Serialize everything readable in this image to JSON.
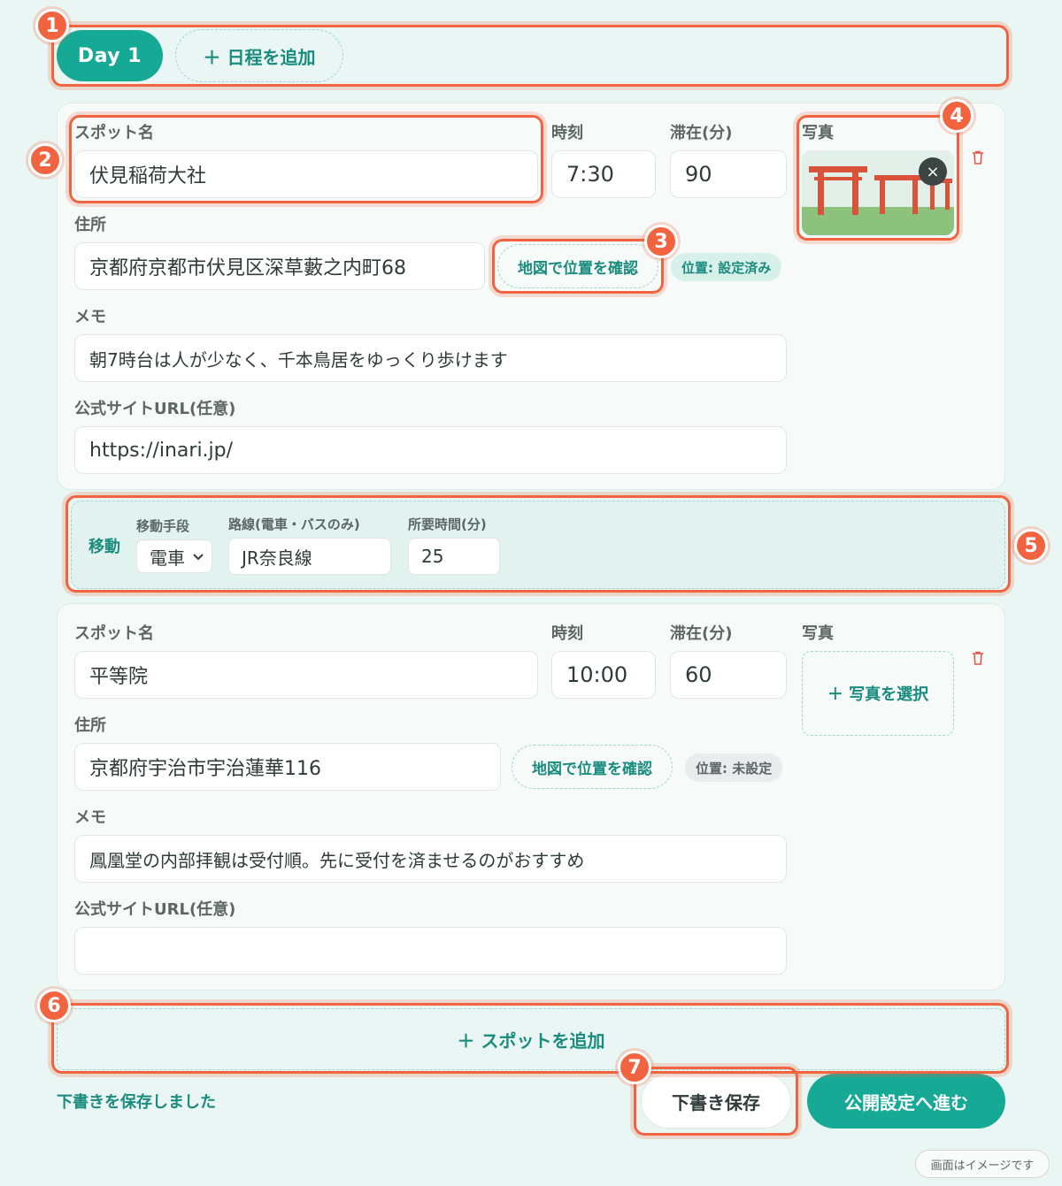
{
  "days": {
    "active_tab": "Day 1",
    "add_day_label": "＋ 日程を追加"
  },
  "spot1": {
    "labels": {
      "name": "スポット名",
      "time": "時刻",
      "stay": "滞在(分)",
      "photo": "写真",
      "address": "住所",
      "memo": "メモ",
      "url": "公式サイトURL(任意)"
    },
    "name": "伏見稲荷大社",
    "time": "7:30",
    "stay": "90",
    "address": "京都府京都市伏見区深草藪之内町68",
    "map_button": "地図で位置を確認",
    "location_status": "位置: 設定済み",
    "memo": "朝7時台は人が少なく、千本鳥居をゆっくり歩けます",
    "url": "https://inari.jp/",
    "remove_photo_icon": "×"
  },
  "transit": {
    "title": "移動",
    "mode_label": "移動手段",
    "mode_value": "電車",
    "route_label": "路線(電車・バスのみ)",
    "route_value": "JR奈良線",
    "duration_label": "所要時間(分)",
    "duration_value": "25"
  },
  "spot2": {
    "labels": {
      "name": "スポット名",
      "time": "時刻",
      "stay": "滞在(分)",
      "photo": "写真",
      "address": "住所",
      "memo": "メモ",
      "url": "公式サイトURL(任意)"
    },
    "name": "平等院",
    "time": "10:00",
    "stay": "60",
    "address": "京都府宇治市宇治蓮華116",
    "map_button": "地図で位置を確認",
    "location_status": "位置: 未設定",
    "memo": "鳳凰堂の内部拝観は受付順。先に受付を済ませるのがおすすめ",
    "url": "",
    "photo_select": "＋ 写真を選択"
  },
  "footer": {
    "add_spot": "＋  スポットを追加",
    "saved_message": "下書きを保存しました",
    "draft_button": "下書き保存",
    "publish_button": "公開設定へ進む",
    "disclaimer": "画面はイメージです"
  },
  "annotations": [
    "1",
    "2",
    "3",
    "4",
    "5",
    "6",
    "7"
  ],
  "colors": {
    "accent": "#16aa96",
    "highlight": "#f2633f",
    "background": "#eaf6f3"
  }
}
